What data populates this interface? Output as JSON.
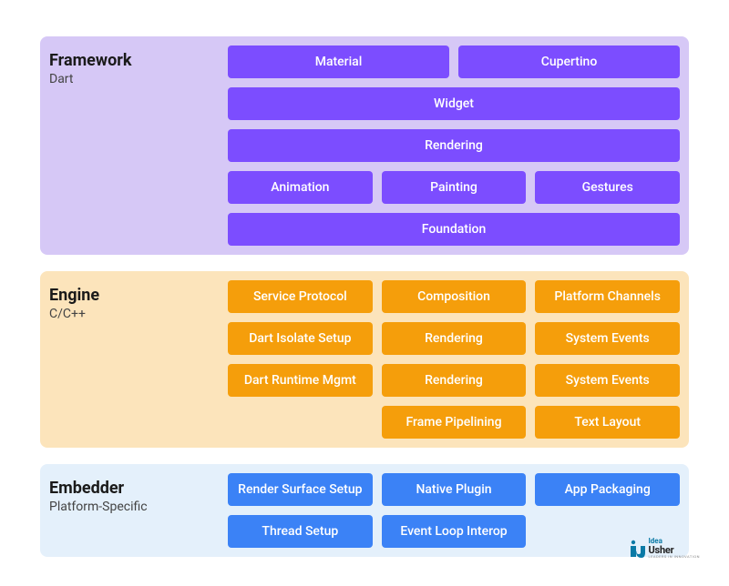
{
  "layers": {
    "framework": {
      "title": "Framework",
      "subtitle": "Dart",
      "rows": [
        [
          "Material",
          "Cupertino"
        ],
        [
          "Widget"
        ],
        [
          "Rendering"
        ],
        [
          "Animation",
          "Painting",
          "Gestures"
        ],
        [
          "Foundation"
        ]
      ]
    },
    "engine": {
      "title": "Engine",
      "subtitle": "C/C++",
      "rows": [
        [
          "Service Protocol",
          "Composition",
          "Platform Channels"
        ],
        [
          "Dart Isolate Setup",
          "Rendering",
          "System Events"
        ],
        [
          "Dart Runtime Mgmt",
          "Rendering",
          "System Events"
        ],
        [
          "",
          "Frame Pipelining",
          "Text Layout"
        ]
      ]
    },
    "embedder": {
      "title": "Embedder",
      "subtitle": "Platform-Specific",
      "rows": [
        [
          "Render Surface Setup",
          "Native Plugin",
          "App Packaging"
        ],
        [
          "Thread Setup",
          "Event Loop Interop",
          ""
        ]
      ]
    }
  },
  "logo": {
    "top": "Idea",
    "bottom": "Usher",
    "tagline": "LEADERS IN INNOVATION"
  }
}
